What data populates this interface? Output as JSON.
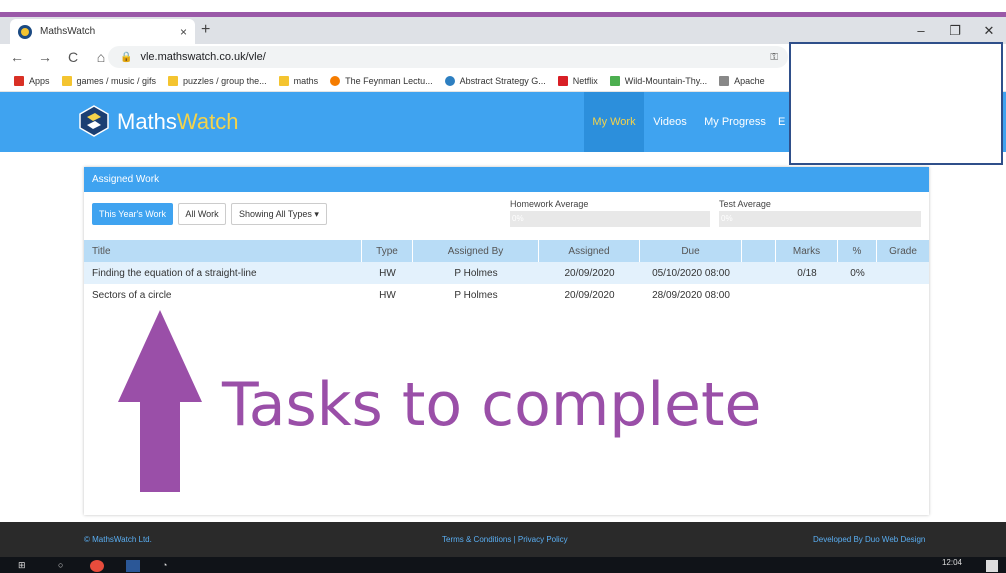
{
  "browser": {
    "tab_title": "MathsWatch",
    "tab_close": "×",
    "new_tab": "+",
    "url": "vle.mathswatch.co.uk/vle/",
    "controls": {
      "minimize": "–",
      "restore": "❐",
      "close": "✕"
    },
    "nav": {
      "back": "←",
      "forward": "→",
      "reload": "C",
      "home": "⌂"
    },
    "lock": "🔒",
    "key": "⚿"
  },
  "bookmarks": [
    {
      "label": "Apps",
      "color": "#d93025"
    },
    {
      "label": "games / music / gifs",
      "color": "#f4c430"
    },
    {
      "label": "puzzles / group the...",
      "color": "#f4c430"
    },
    {
      "label": "maths",
      "color": "#f4c430"
    },
    {
      "label": "The Feynman Lectu...",
      "color": "#f57c00"
    },
    {
      "label": "Abstract Strategy G...",
      "color": "#2d7fc1"
    },
    {
      "label": "Netflix",
      "color": "#d81f26"
    },
    {
      "label": "Wild-Mountain-Thy...",
      "color": "#4caf50"
    },
    {
      "label": "Apache",
      "color": "#888888"
    }
  ],
  "site": {
    "brand_maths": "Maths",
    "brand_watch": "Watch",
    "nav": [
      "My Work",
      "Videos",
      "My Progress",
      "E"
    ]
  },
  "panel": {
    "title": "Assigned Work",
    "buttons": {
      "this_year": "This Year's Work",
      "all": "All Work",
      "types": "Showing All Types ▾"
    },
    "homework_average": {
      "label": "Homework Average",
      "value": "0%"
    },
    "test_average": {
      "label": "Test Average",
      "value": "0%"
    },
    "columns": [
      "Title",
      "Type",
      "Assigned By",
      "Assigned",
      "Due",
      "",
      "Marks",
      "%",
      "Grade"
    ],
    "rows": [
      [
        "Finding the equation of a straight-line",
        "HW",
        "P Holmes",
        "20/09/2020",
        "05/10/2020 08:00",
        "",
        "0/18",
        "0%",
        ""
      ],
      [
        "Sectors of a circle",
        "HW",
        "P Holmes",
        "20/09/2020",
        "28/09/2020 08:00",
        "",
        "",
        "",
        ""
      ]
    ]
  },
  "annotation": "Tasks to complete",
  "footer": {
    "copyright": "© MathsWatch Ltd.",
    "links": "Terms & Conditions | Privacy Policy",
    "developer": "Developed By Duo Web Design"
  },
  "taskbar": {
    "time": "12:04"
  },
  "colors": {
    "brand_blue": "#3fa3f0",
    "purple": "#9a4fa8",
    "yellow": "#f5d34a"
  }
}
